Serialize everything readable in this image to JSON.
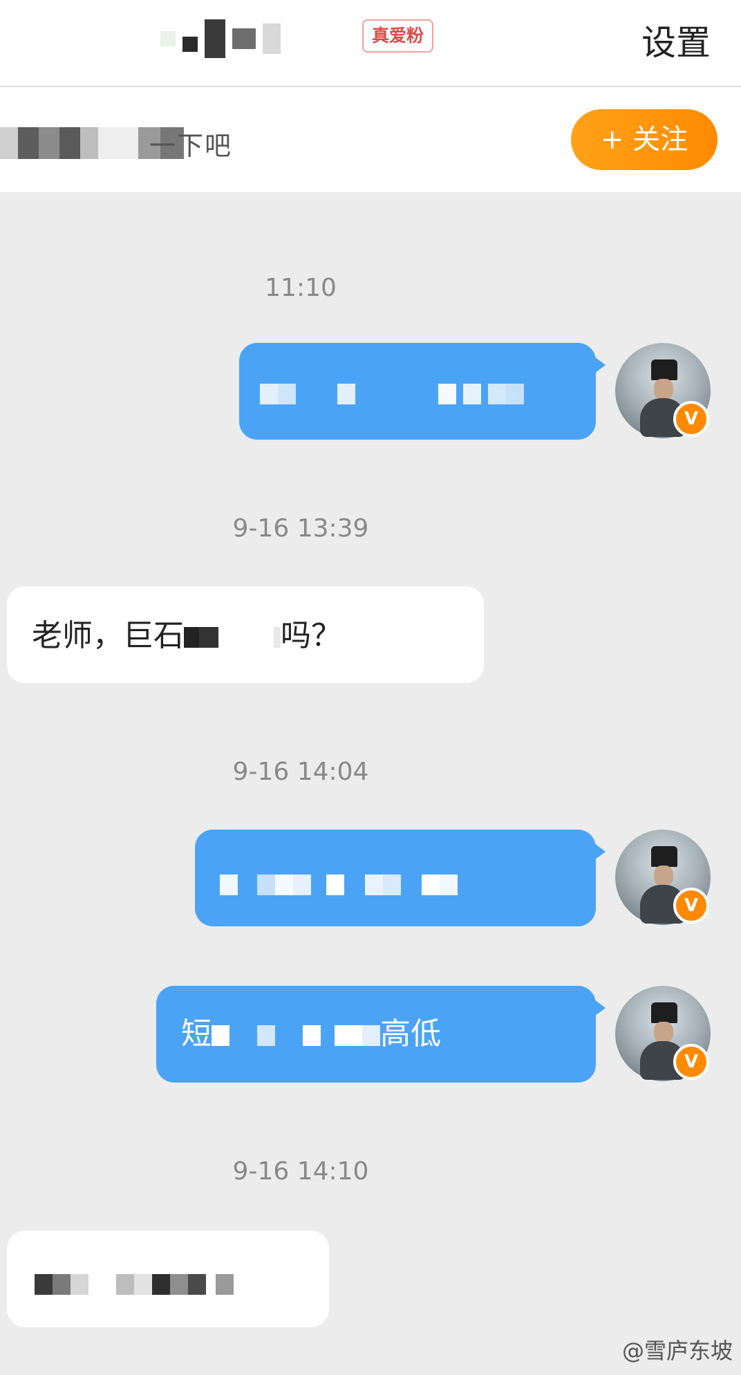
{
  "header": {
    "fan_badge": "真爱粉",
    "settings": "设置"
  },
  "notice": {
    "text": "一下吧",
    "follow_button": "+ 关注"
  },
  "messages": [
    {
      "type": "time",
      "text": "11:10"
    },
    {
      "type": "out",
      "text": "...."
    },
    {
      "type": "time",
      "text": "9-16 13:39"
    },
    {
      "type": "in",
      "text_start": "老师，巨石",
      "text_end": "吗？"
    },
    {
      "type": "time",
      "text": "9-16 14:04"
    },
    {
      "type": "out",
      "text": ""
    },
    {
      "type": "out",
      "text_start": "短",
      "text_end": "高低"
    },
    {
      "type": "time",
      "text": "9-16 14:10"
    },
    {
      "type": "in",
      "text": ""
    }
  ],
  "avatar_badge": "V",
  "watermark": "@雪庐东坡"
}
